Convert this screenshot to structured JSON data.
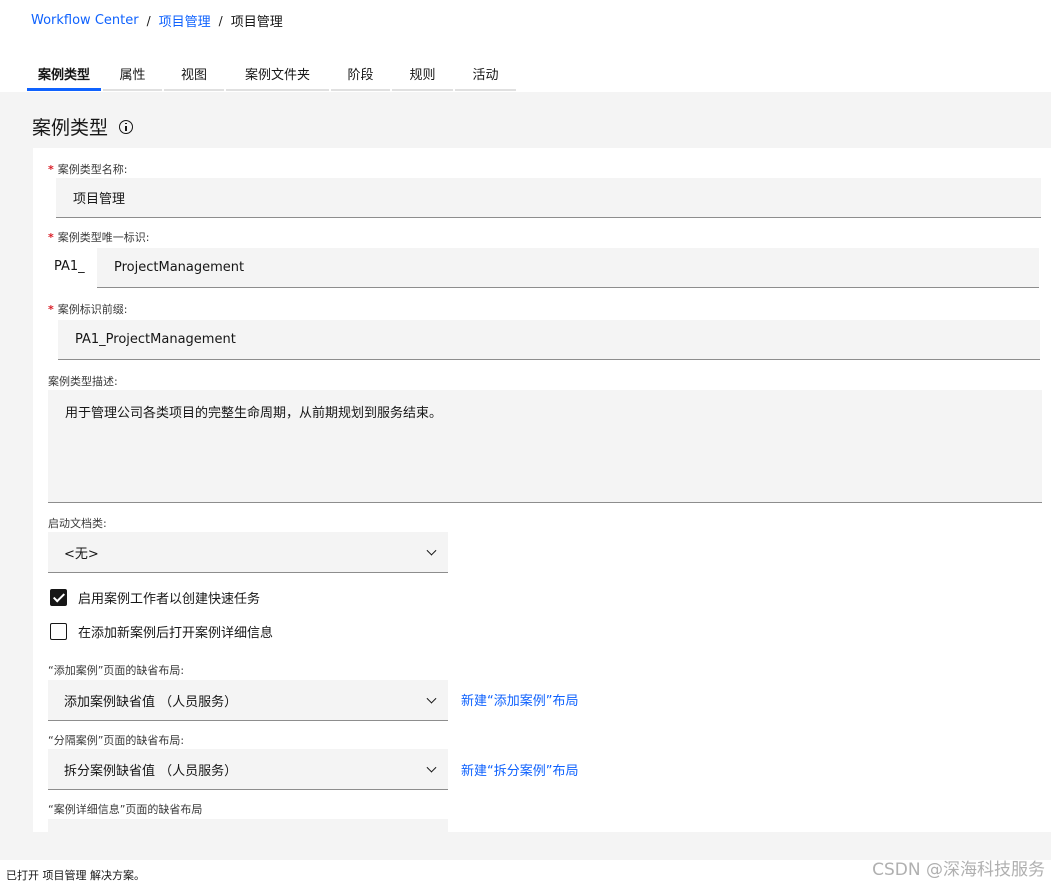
{
  "breadcrumb": {
    "root": "Workflow Center",
    "parent": "项目管理",
    "current": "项目管理",
    "separator": "/"
  },
  "tabs": [
    "案例类型",
    "属性",
    "视图",
    "案例文件夹",
    "阶段",
    "规则",
    "活动"
  ],
  "active_tab": "案例类型",
  "panel": {
    "title": "案例类型",
    "info_icon": "info-icon"
  },
  "form": {
    "name_label": "案例类型名称:",
    "name_value": "项目管理",
    "id_label": "案例类型唯一标识:",
    "id_prefix": "PA1_",
    "id_value": "ProjectManagement",
    "case_prefix_label": "案例标识前缀:",
    "case_prefix_value": "PA1_ProjectManagement",
    "description_label": "案例类型描述:",
    "description_value": "用于管理公司各类项目的完整生命周期，从前期规划到服务结束。",
    "start_doc_label": "启动文档类:",
    "start_doc_value": "<无>",
    "checkbox1_label": "启用案例工作者以创建快速任务",
    "checkbox1_checked": true,
    "checkbox2_label": "在添加新案例后打开案例详细信息",
    "checkbox2_checked": false,
    "add_layout_label": "“添加案例”页面的缺省布局:",
    "add_layout_value": "添加案例缺省值 （人员服务）",
    "add_layout_link": "新建“添加案例”布局",
    "split_layout_label": "“分隔案例”页面的缺省布局:",
    "split_layout_value": "拆分案例缺省值 （人员服务）",
    "split_layout_link": "新建“拆分案例”布局",
    "detail_layout_label": "“案例详细信息”页面的缺省布局"
  },
  "required_mark": "*",
  "status_bar": "已打开 项目管理 解决方案。",
  "watermark": "CSDN @深海科技服务",
  "colors": {
    "link": "#0f62fe",
    "required": "#da1e28",
    "field_bg": "#f4f4f4"
  }
}
